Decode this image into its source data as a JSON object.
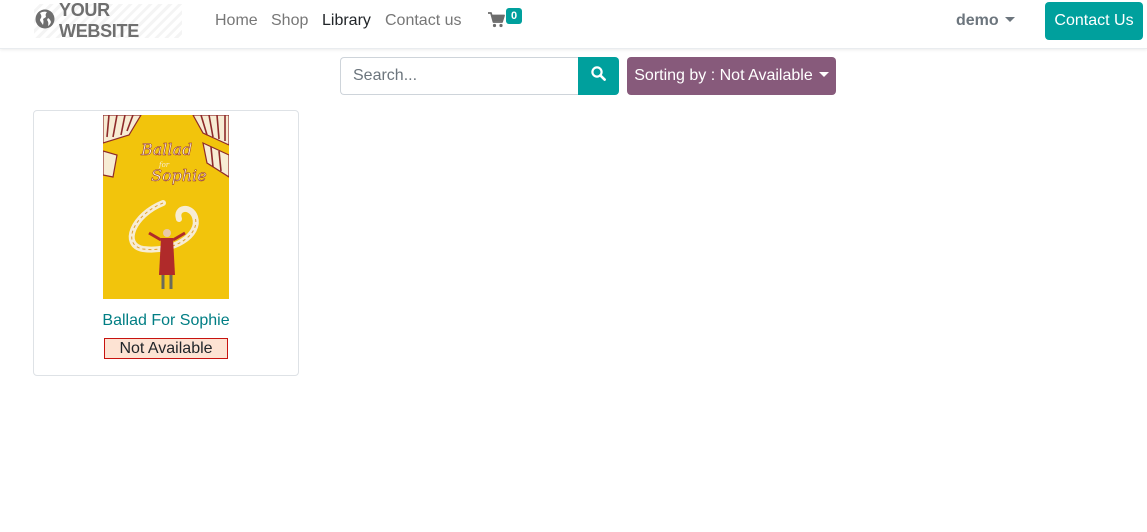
{
  "header": {
    "logo_text": "YOUR WEBSITE",
    "nav": [
      {
        "label": "Home"
      },
      {
        "label": "Shop"
      },
      {
        "label": "Library",
        "active": true
      },
      {
        "label": "Contact us"
      }
    ],
    "cart_count": "0",
    "user_name": "demo",
    "contact_button": "Contact Us"
  },
  "toolbar": {
    "search_placeholder": "Search...",
    "sort_label": "Sorting by : Not Available"
  },
  "books": [
    {
      "title": "Ballad For Sophie",
      "status": "Not Available",
      "cover_text": [
        "Ballad",
        "for",
        "Sophie"
      ]
    }
  ],
  "colors": {
    "primary": "#00a09d",
    "secondary": "#875a7b",
    "link": "#017e84",
    "status_border": "#c7130f",
    "status_bg": "#fde3d3"
  },
  "icons": {
    "logo": "globe-icon",
    "cart": "shopping-cart-icon",
    "search": "search-icon",
    "caret": "caret-down-icon"
  }
}
